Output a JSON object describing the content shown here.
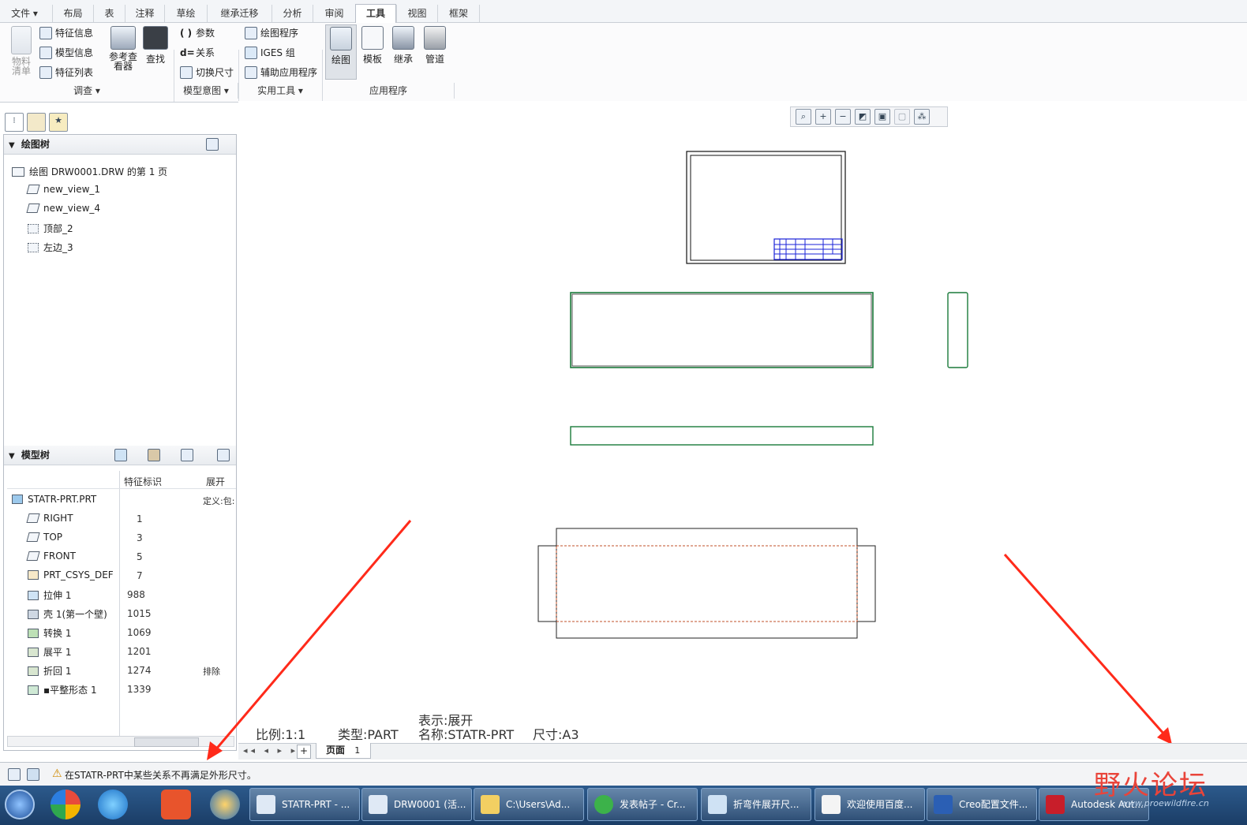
{
  "menu": {
    "tabs": [
      "文件 ▾",
      "布局",
      "表",
      "注释",
      "草绘",
      "继承迁移",
      "分析",
      "审阅",
      "工具",
      "视图",
      "框架"
    ],
    "active": "工具"
  },
  "ribbon": {
    "bom_label": "物料\n清单",
    "feature_info": "特征信息",
    "model_info": "模型信息",
    "feature_list": "特征列表",
    "ref_viewer": "参考查\n看器",
    "find": "查找",
    "params": "参数",
    "relations": "关系",
    "toggle_dims": "切换尺寸",
    "drawing_program": "绘图程序",
    "iges_group": "IGES 组",
    "aux_apps": "辅助应用程序",
    "drawing": "绘图",
    "template": "模板",
    "inherit": "继承",
    "piping": "管道",
    "groups": [
      "调查 ▾",
      "模型意图 ▾",
      "实用工具 ▾",
      "应用程序"
    ]
  },
  "drawing_tree": {
    "title": "绘图树",
    "root": "绘图 DRW0001.DRW 的第 1 页",
    "items": [
      "new_view_1",
      "new_view_4",
      "顶部_2",
      "左边_3"
    ]
  },
  "model_tree": {
    "title": "模型树",
    "col_id": "特征标识",
    "col_expand": "展开",
    "root": "STATR-PRT.PRT",
    "root_extra": "定义:包:",
    "rows": [
      {
        "name": "RIGHT",
        "id": "1",
        "extra": ""
      },
      {
        "name": "TOP",
        "id": "3",
        "extra": ""
      },
      {
        "name": "FRONT",
        "id": "5",
        "extra": ""
      },
      {
        "name": "PRT_CSYS_DEF",
        "id": "7",
        "extra": ""
      },
      {
        "name": "拉伸 1",
        "id": "988",
        "extra": ""
      },
      {
        "name": "壳 1(第一个壁)",
        "id": "1015",
        "extra": ""
      },
      {
        "name": "转换 1",
        "id": "1069",
        "extra": ""
      },
      {
        "name": "展平 1",
        "id": "1201",
        "extra": ""
      },
      {
        "name": "折回 1",
        "id": "1274",
        "extra": "排除"
      },
      {
        "name": "▪平整形态 1",
        "id": "1339",
        "extra": ""
      }
    ]
  },
  "drawing_info": {
    "scale": "比例:1:1",
    "type": "类型:PART",
    "display": "表示:展开",
    "name": "名称:STATR-PRT",
    "size": "尺寸:A3"
  },
  "page_tab": {
    "label": "页面",
    "number": "1"
  },
  "status": {
    "message": "在STATR-PRT中某些关系不再满足外形尺寸。"
  },
  "taskbar": {
    "apps": [
      "STATR-PRT - ...",
      "DRW0001 (活...",
      "C:\\Users\\Ad...",
      "发表帖子 - Cr...",
      "折弯件展开尺...",
      "欢迎使用百度...",
      "Creo配置文件...",
      "Autodesk Aut..."
    ]
  },
  "watermark": {
    "text": "野火论坛",
    "url": "www.proewildfire.cn"
  },
  "colors": {
    "arrow": "#ff2a1a",
    "view_frame": "#1a7a3a",
    "title_block": "#1a22d8"
  }
}
